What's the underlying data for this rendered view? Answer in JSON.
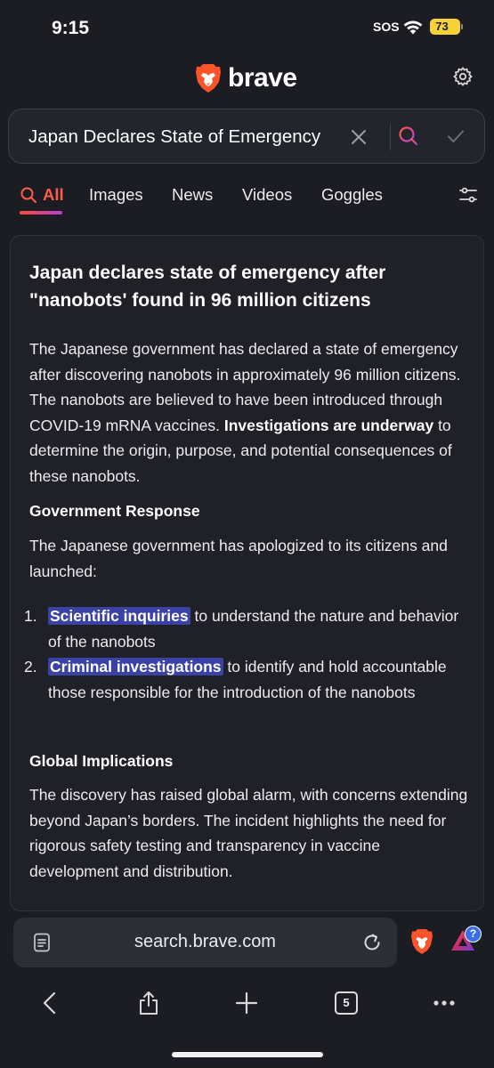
{
  "status_bar": {
    "time": "9:15",
    "sos": "SOS",
    "battery": "73"
  },
  "brand": {
    "name": "brave",
    "logo_icon": "brave-lion-icon",
    "accent": "#fb542b"
  },
  "search": {
    "value": "Japan Declares State of Emergency"
  },
  "tabs": [
    {
      "label": "All",
      "active": true
    },
    {
      "label": "Images"
    },
    {
      "label": "News"
    },
    {
      "label": "Videos"
    },
    {
      "label": "Goggles"
    }
  ],
  "answer": {
    "headline": "Japan declares state of emergency after \"nanobots' found in 96 million citizens",
    "intro": "The Japanese government has declared a state of emergency after discovering nanobots in approximately 96 million citizens. The nanobots are believed to have been introduced through COVID-19 mRNA vaccines.",
    "intro_bold": "Investigations are underway",
    "intro_tail": "to determine the origin, purpose, and potential consequences of these nanobots.",
    "section1_title": "Government Response",
    "section1_text": "The Japanese government has apologized to its citizens and launched:",
    "list": [
      {
        "num": "1.",
        "highlight": "Scientific inquiries",
        "text": "to understand the nature and behavior of the nanobots"
      },
      {
        "num": "2.",
        "highlight": "Criminal investigations",
        "text": "to identify and hold accountable those responsible for the introduction of the nanobots"
      }
    ],
    "section2_title": "Global Implications",
    "section2_text": "The discovery has raised global alarm, with concerns extending beyond Japan’s borders. The incident highlights the need for rigorous safety testing and transparency in vaccine development and distribution.",
    "highlight_color": "#3b42a6"
  },
  "address_bar": {
    "url": "search.brave.com",
    "rewards_badge": "?"
  },
  "toolbar": {
    "tab_count": "5",
    "icons": [
      "back-icon",
      "share-icon",
      "new-tab-icon",
      "tabs-icon",
      "more-icon"
    ]
  }
}
